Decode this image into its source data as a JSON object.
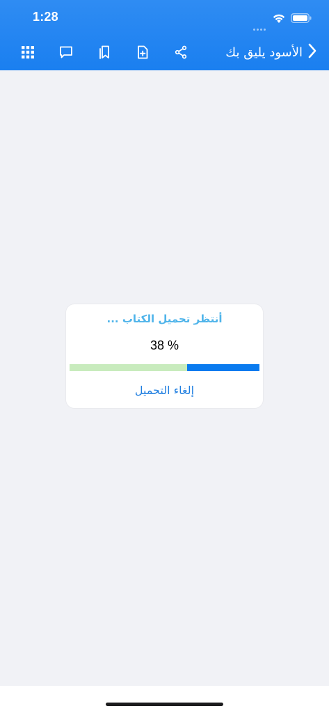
{
  "status_bar": {
    "time": "1:28"
  },
  "nav": {
    "title": "الأسود يليق بك",
    "icons": [
      "grid-icon",
      "comment-icon",
      "bookmarks-icon",
      "add-document-icon",
      "share-icon",
      "back-chevron-icon"
    ]
  },
  "download_dialog": {
    "waiting_text": "أنتظر تحميل الكتاب ...",
    "percent_text": "38 %",
    "progress": 0.38,
    "cancel_label": "إلغاء التحميل"
  },
  "colors": {
    "nav_background": "#1a7ff0",
    "page_background": "#f1f2f6",
    "progress_fill": "#0a7bef",
    "progress_track": "#c8ebbd",
    "waiting_text": "#4fb4ea",
    "cancel_text": "#1f7ee0"
  }
}
